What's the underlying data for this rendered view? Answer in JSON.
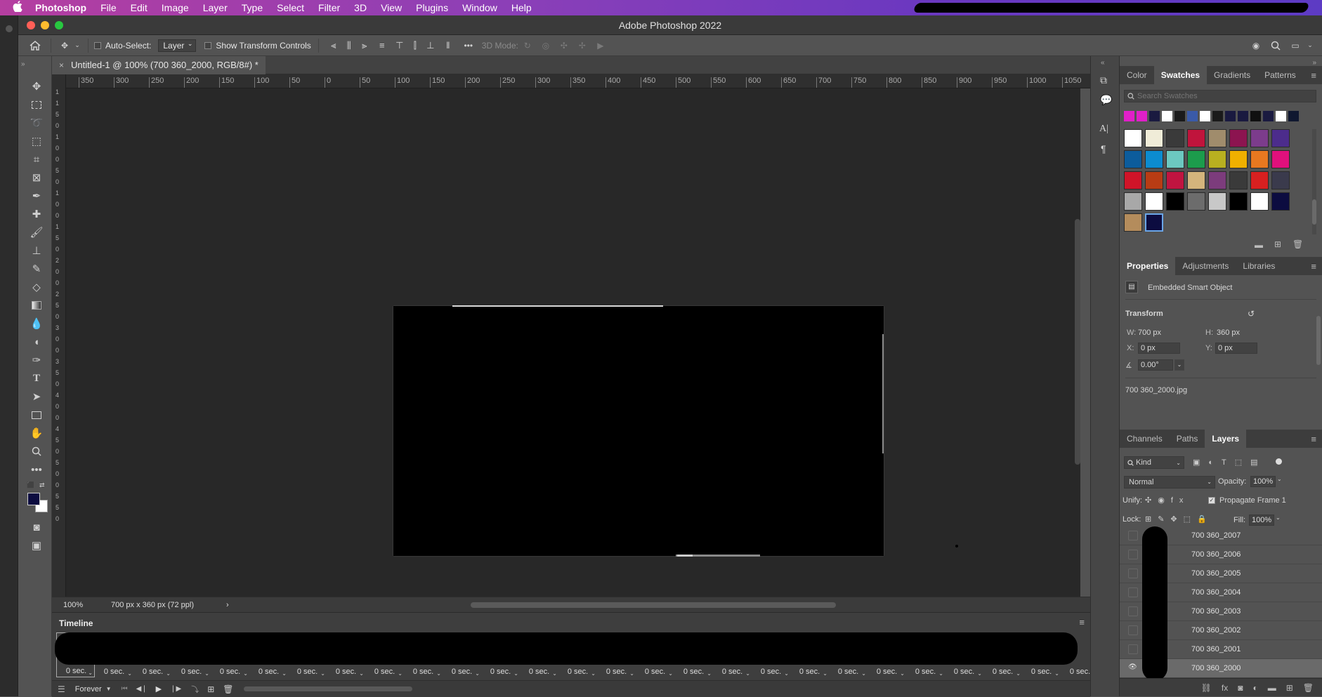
{
  "menubar": {
    "apple": "",
    "app": "Photoshop",
    "items": [
      "File",
      "Edit",
      "Image",
      "Layer",
      "Type",
      "Select",
      "Filter",
      "3D",
      "View",
      "Plugins",
      "Window",
      "Help"
    ]
  },
  "window": {
    "title": "Adobe Photoshop 2022"
  },
  "options": {
    "auto_select": "Auto-Select:",
    "layer_select": "Layer",
    "show_transform": "Show Transform Controls",
    "three_d_mode": "3D Mode:",
    "more": "•••"
  },
  "document": {
    "tab": "Untitled-1 @ 100% (700 360_2000, RGB/8#) *"
  },
  "ruler_h": [
    "350",
    "300",
    "250",
    "200",
    "150",
    "100",
    "50",
    "0",
    "50",
    "100",
    "150",
    "200",
    "250",
    "300",
    "350",
    "400",
    "450",
    "500",
    "550",
    "600",
    "650",
    "700",
    "750",
    "800",
    "850",
    "900",
    "950",
    "1000",
    "1050"
  ],
  "ruler_v": [
    "1",
    "1",
    "5",
    "0",
    "1",
    "0",
    "0",
    "5",
    "0",
    "1",
    "0",
    "0",
    "1",
    "5",
    "0",
    "2",
    "0",
    "0",
    "2",
    "5",
    "0",
    "3",
    "0",
    "0",
    "3",
    "5",
    "0",
    "4",
    "0",
    "0",
    "4",
    "5",
    "0",
    "5",
    "0",
    "0",
    "5",
    "5",
    "0"
  ],
  "status": {
    "zoom": "100%",
    "size": "700 px x 360 px (72 ppl)",
    "arrow": "›"
  },
  "timeline": {
    "title": "Timeline",
    "frame_time": "0 sec.",
    "loop": "Forever"
  },
  "swatches": {
    "tabs": [
      "Color",
      "Swatches",
      "Gradients",
      "Patterns"
    ],
    "search_placeholder": "Search Swatches",
    "recent": [
      "#e020c8",
      "#e020c8",
      "#1a1a40",
      "#ffffff",
      "#1a1a1a",
      "#3a5aa8",
      "#ffffff",
      "#1a1a1a",
      "#1a1a40",
      "#1a1a40",
      "#101010",
      "#1a1a40",
      "#ffffff",
      "#101830"
    ],
    "grid": [
      [
        "#ffffff",
        "#f0ecd8",
        "#3a3a3a",
        "#c0143c",
        "#a08c6c",
        "#8c1450",
        "#7c3c8c",
        "#4c2c8c"
      ],
      [
        "#0c5c9c",
        "#0c8cd0",
        "#6cc8c0",
        "#1c9c4c",
        "#b8b020",
        "#f0b000",
        "#e87820",
        "#e0107c"
      ],
      [
        "#d01428",
        "#b83c14",
        "#c01440",
        "#d4b47c",
        "#7c3c7c",
        "#3a3a3a",
        "#d82020",
        "#3a3a4c"
      ],
      [
        "#a8a8a8",
        "#ffffff",
        "#000000",
        "#6c6c6c",
        "#c8c8c8",
        "#000000",
        "#ffffff",
        "#0c0c40"
      ],
      [
        "#b48c5c",
        "#0c0c40"
      ]
    ]
  },
  "properties": {
    "tabs": [
      "Properties",
      "Adjustments",
      "Libraries"
    ],
    "type": "Embedded Smart Object",
    "transform": "Transform",
    "w_label": "W:",
    "w": "700 px",
    "h_label": "H:",
    "h": "360 px",
    "x_label": "X:",
    "x": "0 px",
    "y_label": "Y:",
    "y": "0 px",
    "angle": "0.00°",
    "file": "700 360_2000.jpg"
  },
  "layers": {
    "tabs": [
      "Channels",
      "Paths",
      "Layers"
    ],
    "kind": "Kind",
    "blend": "Normal",
    "opacity_label": "Opacity:",
    "opacity": "100%",
    "unify": "Unify:",
    "propagate": "Propagate Frame 1",
    "lock": "Lock:",
    "fill_label": "Fill:",
    "fill": "100%",
    "items": [
      "700 360_2007",
      "700 360_2006",
      "700 360_2005",
      "700 360_2004",
      "700 360_2003",
      "700 360_2002",
      "700 360_2001",
      "700 360_2000"
    ]
  }
}
